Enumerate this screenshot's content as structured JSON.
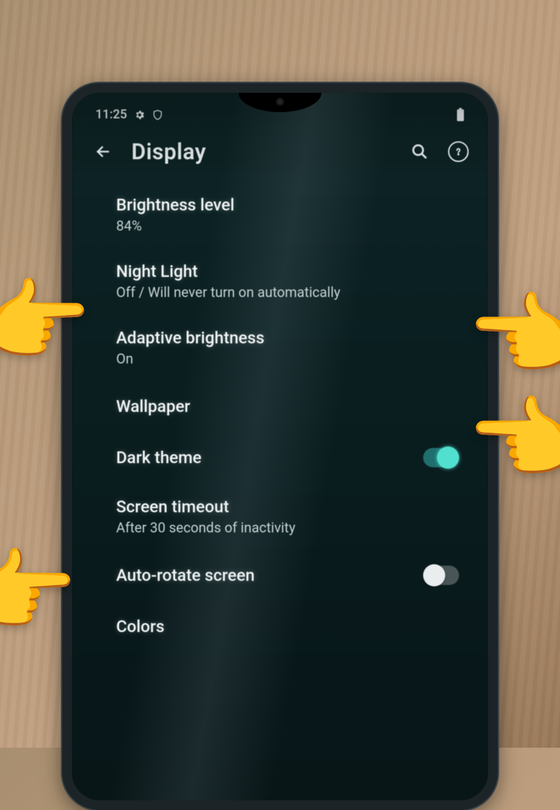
{
  "statusbar": {
    "time": "11:25"
  },
  "header": {
    "title": "Display"
  },
  "items": {
    "brightness": {
      "title": "Brightness level",
      "subtitle": "84%"
    },
    "nightlight": {
      "title": "Night Light",
      "subtitle": "Off / Will never turn on automatically"
    },
    "adaptive": {
      "title": "Adaptive brightness",
      "subtitle": "On"
    },
    "wallpaper": {
      "title": "Wallpaper"
    },
    "darktheme": {
      "title": "Dark theme",
      "toggle": "on"
    },
    "timeout": {
      "title": "Screen timeout",
      "subtitle": "After 30 seconds of inactivity"
    },
    "autorotate": {
      "title": "Auto-rotate screen",
      "toggle": "off"
    },
    "colors": {
      "title": "Colors"
    }
  }
}
